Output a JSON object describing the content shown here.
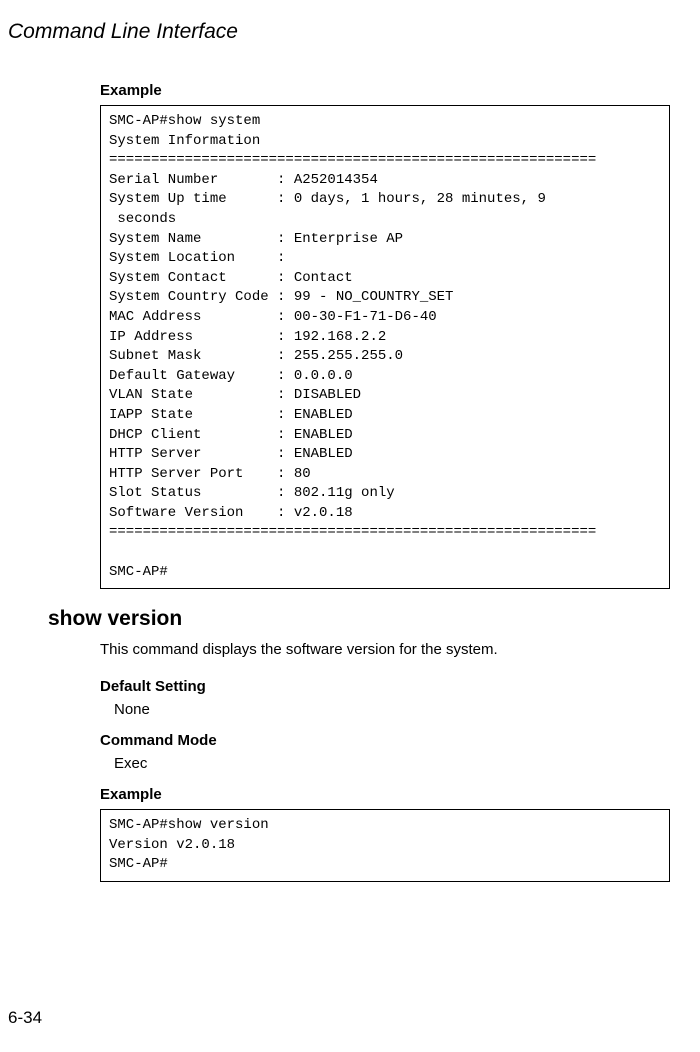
{
  "header": "Command Line Interface",
  "example1": {
    "heading": "Example",
    "terminal": "SMC-AP#show system\nSystem Information\n==========================================================\nSerial Number       : A252014354\nSystem Up time      : 0 days, 1 hours, 28 minutes, 9 \n seconds\nSystem Name         : Enterprise AP\nSystem Location     : \nSystem Contact      : Contact\nSystem Country Code : 99 - NO_COUNTRY_SET\nMAC Address         : 00-30-F1-71-D6-40\nIP Address          : 192.168.2.2\nSubnet Mask         : 255.255.255.0\nDefault Gateway     : 0.0.0.0\nVLAN State          : DISABLED\nIAPP State          : ENABLED\nDHCP Client         : ENABLED\nHTTP Server         : ENABLED\nHTTP Server Port    : 80\nSlot Status         : 802.11g only\nSoftware Version    : v2.0.18\n==========================================================\n\nSMC-AP#"
  },
  "command": {
    "title": "show version",
    "description": "This command displays the software version for the system.",
    "default_setting": {
      "heading": "Default Setting",
      "value": "None"
    },
    "command_mode": {
      "heading": "Command Mode",
      "value": "Exec"
    }
  },
  "example2": {
    "heading": "Example",
    "terminal": "SMC-AP#show version\nVersion v2.0.18\nSMC-AP#"
  },
  "page_number": "6-34"
}
